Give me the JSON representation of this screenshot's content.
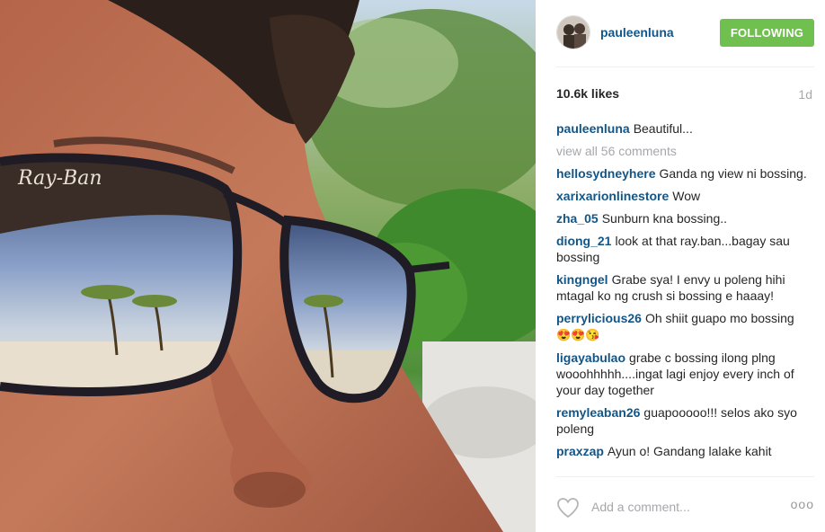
{
  "post": {
    "username": "pauleenluna",
    "follow_label": "FOLLOWING",
    "likes": "10.6k likes",
    "age": "1d"
  },
  "caption": {
    "user": "pauleenluna",
    "text": "Beautiful..."
  },
  "view_all": "view all 56 comments",
  "comments": [
    {
      "user": "hellosydneyhere",
      "text": "Ganda ng view ni bossing."
    },
    {
      "user": "xarixarionlinestore",
      "text": "Wow"
    },
    {
      "user": "zha_05",
      "text": "Sunburn kna bossing.."
    },
    {
      "user": "diong_21",
      "text": "look at that ray.ban...bagay sau bossing"
    },
    {
      "user": "kingngel",
      "text": "Grabe sya! I envy u poleng hihi mtagal ko ng crush si bossing e haaay!"
    },
    {
      "user": "perrylicious26",
      "text": "Oh shiit guapo mo bossing",
      "emoji": "😍😍😘"
    },
    {
      "user": "ligayabulao",
      "text": "grabe c bossing ilong plng wooohhhhh....ingat lagi enjoy every inch of your day together"
    },
    {
      "user": "remyleaban26",
      "text": "guapooooo!!! selos ako syo poleng"
    },
    {
      "user": "praxzap",
      "text": "Ayun o! Gandang lalake kahit"
    }
  ],
  "footer": {
    "add_comment_placeholder": "Add a comment...",
    "more_label": "ooo"
  },
  "photo_text": {
    "sunglasses_brand": "Ray-Ban"
  },
  "colors": {
    "username_blue": "#125688",
    "follow_green": "#70c050",
    "muted_grey": "#a5a7aa"
  }
}
